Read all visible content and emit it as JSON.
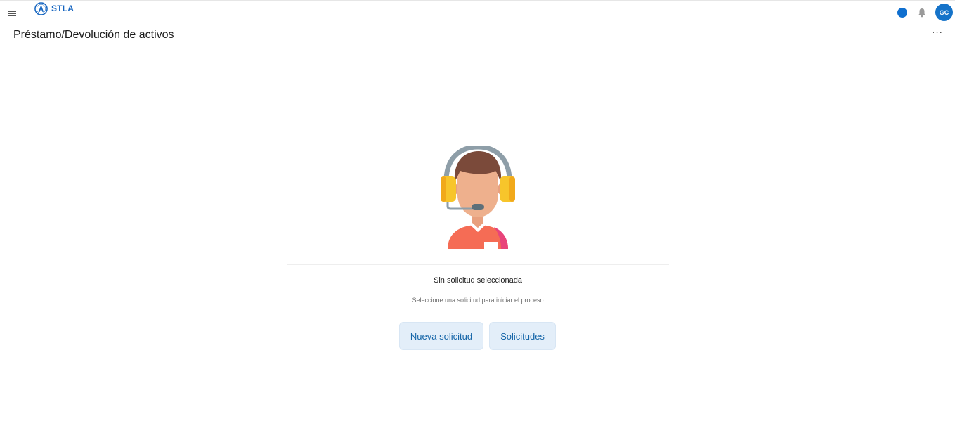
{
  "header": {
    "brand": "STLA",
    "avatar_initials": "GC",
    "accent_color": "#1573c9",
    "icons": [
      "menu-icon",
      "logo-icon",
      "status-dot-icon",
      "bell-icon",
      "more-icon"
    ]
  },
  "page": {
    "title": "Préstamo/Devolución de activos",
    "more_label": "···"
  },
  "empty_state": {
    "illustration": "support-agent-headset",
    "title": "Sin solicitud seleccionada",
    "subtitle": "Seleccione una solicitud para iniciar el proceso",
    "buttons": {
      "new_request": "Nueva solicitud",
      "requests": "Solicitudes"
    }
  }
}
